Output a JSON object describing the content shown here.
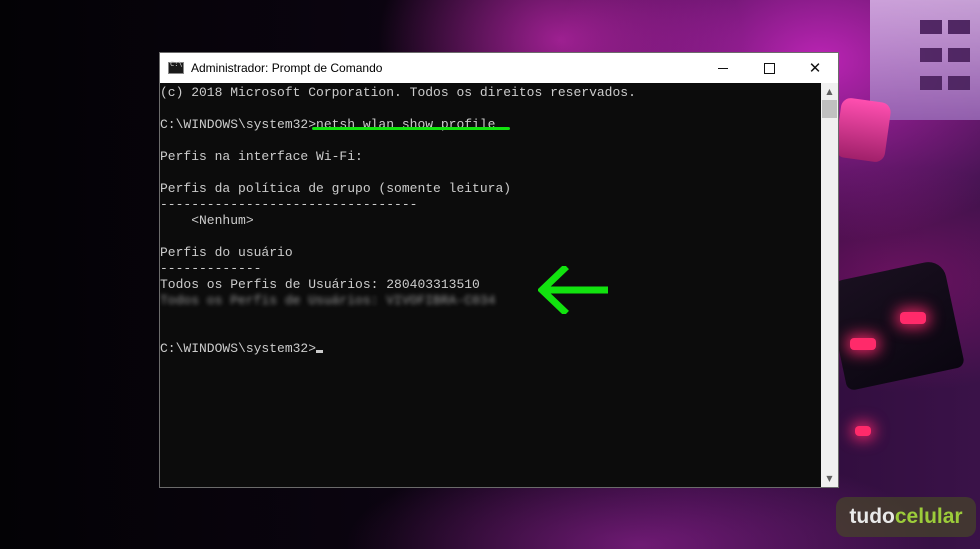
{
  "window": {
    "title": "Administrador: Prompt de Comando",
    "minimize_glyph": "",
    "close_glyph": "✕"
  },
  "console": {
    "lines": [
      "(c) 2018 Microsoft Corporation. Todos os direitos reservados.",
      "",
      "C:\\WINDOWS\\system32>netsh wlan show profile",
      "",
      "Perfis na interface Wi-Fi:",
      "",
      "Perfis da política de grupo (somente leitura)",
      "---------------------------------",
      "    <Nenhum>",
      "",
      "Perfis do usuário",
      "-------------",
      "Todos os Perfis de Usuários: 280403313510",
      "Todos os Perfis de Usuários: VIVOFIBRA-C034",
      "",
      "",
      "C:\\WINDOWS\\system32>"
    ]
  },
  "scrollbar": {
    "up_glyph": "▲",
    "down_glyph": "▼"
  },
  "annotations": {
    "highlight_color": "#12e30f"
  },
  "watermark": {
    "part1": "tudo",
    "part2": "celular"
  },
  "colors": {
    "console_bg": "#0c0c0c",
    "console_text": "#cccccc"
  }
}
